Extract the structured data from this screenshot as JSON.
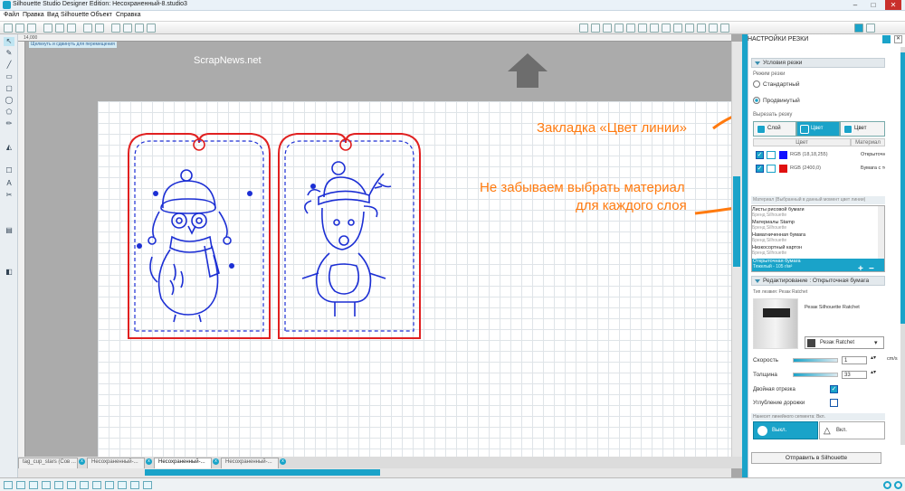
{
  "window": {
    "title": "Silhouette Studio Designer Edition: Несохраненный-8.studio3",
    "min": "–",
    "max": "□",
    "close": "✕"
  },
  "menu": [
    "Файл",
    "Правка",
    "Вид",
    "Silhouette",
    "Объект",
    "Справка"
  ],
  "toolbar": {
    "zoom_value": "14,000",
    "position_hint": "Щелкнуть и сдвинуть для перемещения"
  },
  "left_tools": [
    "↖",
    "✎",
    "╱",
    "▭",
    "▢",
    "◯",
    "⬠",
    "✏",
    "◭",
    "☐",
    "A",
    "✂",
    "▤",
    "◧"
  ],
  "canvas": {
    "watermark": "ScrapNews.net",
    "colors": {
      "cut_red": "#e02020",
      "draw_blue": "#1c2fd4",
      "accent": "#1aa3c9",
      "annot_orange": "#ff7a0f"
    }
  },
  "tags": [
    {
      "id": "owl",
      "name": "tag-owl"
    },
    {
      "id": "deer",
      "name": "tag-deer"
    }
  ],
  "annotations": {
    "line_color_tab": "Закладка «Цвет линии»",
    "material_line1": "Не забываем выбрать материал",
    "material_line2": "для каждого слоя"
  },
  "doc_tabs": [
    {
      "label": "tag_cup_stars (Сов ...",
      "active": false
    },
    {
      "label": "Несохраненный-...",
      "active": false
    },
    {
      "label": "Несохраненный-...",
      "active": true
    },
    {
      "label": "Несохраненный-...",
      "active": false
    }
  ],
  "panel": {
    "title": "НАСТРОЙКИ РЕЗКИ",
    "cut_conditions": "Условия резки",
    "mode_label": "Режим резки",
    "mode_standard": "Стандартный",
    "mode_advanced": "Продвинутый",
    "cut_by_label": "Вырезать резку",
    "seg_layer": "Слой",
    "seg_line_color": "Цвет линии",
    "seg_fill_color": "Цвет заполн.",
    "col_color": "Цвет",
    "col_material": "Материал",
    "rows": [
      {
        "rgb": "RGB (18,18,255)",
        "material": "Открыточная бумага",
        "color": "#1010ff"
      },
      {
        "rgb": "RGB (2400,0)",
        "material": "Бумага с текстурой",
        "color": "#e01010"
      }
    ],
    "materials_caption": "Материал (Выбранный в данный момент цвет линии)",
    "materials": [
      {
        "name": "Листы рисовой бумаги",
        "brand": "Бренд Silhouette"
      },
      {
        "name": "Материалы Stamp",
        "brand": "Бренд Silhouette"
      },
      {
        "name": "Намагниченная бумага",
        "brand": "Бренд Silhouette"
      },
      {
        "name": "Низкосортный картон",
        "brand": "Бренд Silhouette"
      },
      {
        "name": "Открыточная бумага",
        "brand": "Тяжелый - 105 г/м²",
        "selected": true
      }
    ],
    "edit_header": "Редактирование : Открыточная бумага",
    "blade_caption": "Тип лезвия: Резак Ratchet",
    "blade_name": "Резак Silhouette Ratchet",
    "blade_select": "Резак Ratchet",
    "speed_label": "Скорость",
    "speed_value": "1",
    "speed_unit": "cm/s",
    "thickness_label": "Толщина",
    "thickness_value": "33",
    "double_cut": "Двойная отрезка",
    "track_enhance": "Углубление дорожки",
    "overcut_caption": "Нанесет линейного сегмента: Вкл.",
    "on_label": "Выкл.",
    "off_label": "Вкл.",
    "send_button": "Отправить в Silhouette"
  }
}
